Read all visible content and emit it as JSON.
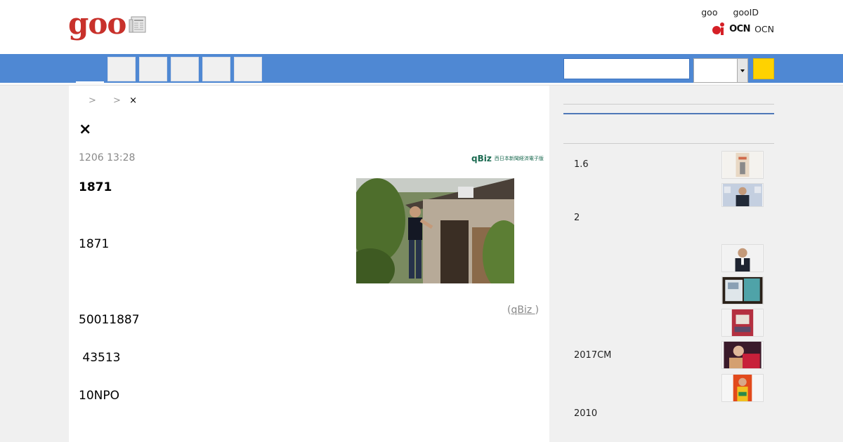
{
  "header": {
    "logo": "goo",
    "links": [
      "goo",
      "gooID"
    ],
    "ocn_mark": "OCN",
    "ocn_label": "OCN"
  },
  "breadcrumb": {
    "sep1": ">",
    "sep2": ">",
    "current": "×"
  },
  "article": {
    "title": "×",
    "date": "1206 13:28",
    "publisher_logo": "qBiz",
    "publisher_sub": "西日本新聞経済電子版",
    "lead": "1871",
    "paragraphs": [
      "1871",
      "50011887",
      " 43513",
      "10NPO"
    ],
    "credit_prefix": "(",
    "credit_link": "qBiz ",
    "credit_suffix": ")"
  },
  "sidebar": {
    "items": [
      {
        "text": "1.6"
      },
      {
        "text": "2"
      },
      {
        "text": "2017CM"
      },
      {
        "text": "2010"
      }
    ]
  },
  "colors": {
    "brand_red": "#c8312b",
    "nav_blue": "#4f88d3",
    "search_yellow": "#ffd200"
  }
}
